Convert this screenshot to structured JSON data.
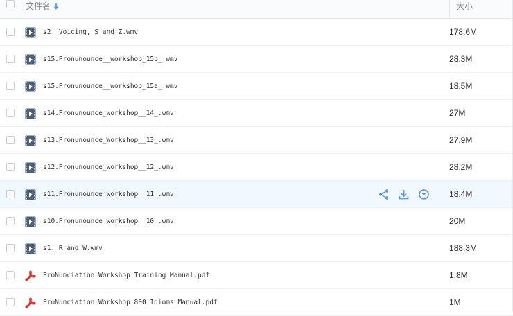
{
  "header": {
    "name_label": "文件名",
    "size_label": "大小"
  },
  "files": [
    {
      "name": "s2. Voicing, S and Z.wmv",
      "size": "178.6M",
      "icon": "video-icon"
    },
    {
      "name": "s15.Pronunounce__workshop_15b_.wmv",
      "size": "28.3M",
      "icon": "video-icon"
    },
    {
      "name": "s15.Pronunounce__workshop_15a_.wmv",
      "size": "18.5M",
      "icon": "video-icon"
    },
    {
      "name": "s14.Pronunounce_workshop__14_.wmv",
      "size": "27M",
      "icon": "video-icon"
    },
    {
      "name": "s13.Pronunounce_Workshop__13_.wmv",
      "size": "27.9M",
      "icon": "video-icon"
    },
    {
      "name": "s12.Pronunounce_workshop__12_.wmv",
      "size": "28.2M",
      "icon": "video-icon"
    },
    {
      "name": "s11.Pronunounce_workshop__11_.wmv",
      "size": "18.4M",
      "icon": "video-icon",
      "hovered": true
    },
    {
      "name": "s10.Pronunounce_workshop__10_.wmv",
      "size": "20M",
      "icon": "video-icon"
    },
    {
      "name": "s1. R and W.wmv",
      "size": "188.3M",
      "icon": "video-icon"
    },
    {
      "name": "ProNunciation Workshop_Training_Manual.pdf",
      "size": "1.8M",
      "icon": "pdf-icon"
    },
    {
      "name": "ProNunciation Workshop_800_Idioms_Manual.pdf",
      "size": "1M",
      "icon": "pdf-icon"
    }
  ],
  "hover_actions": [
    "share-icon",
    "download-icon",
    "more-icon"
  ],
  "colors": {
    "video_icon": "#4e5f75",
    "pdf_icon": "#d6322b",
    "action_icon": "#5b9bd5",
    "hover_row": "#f2f8ff"
  }
}
